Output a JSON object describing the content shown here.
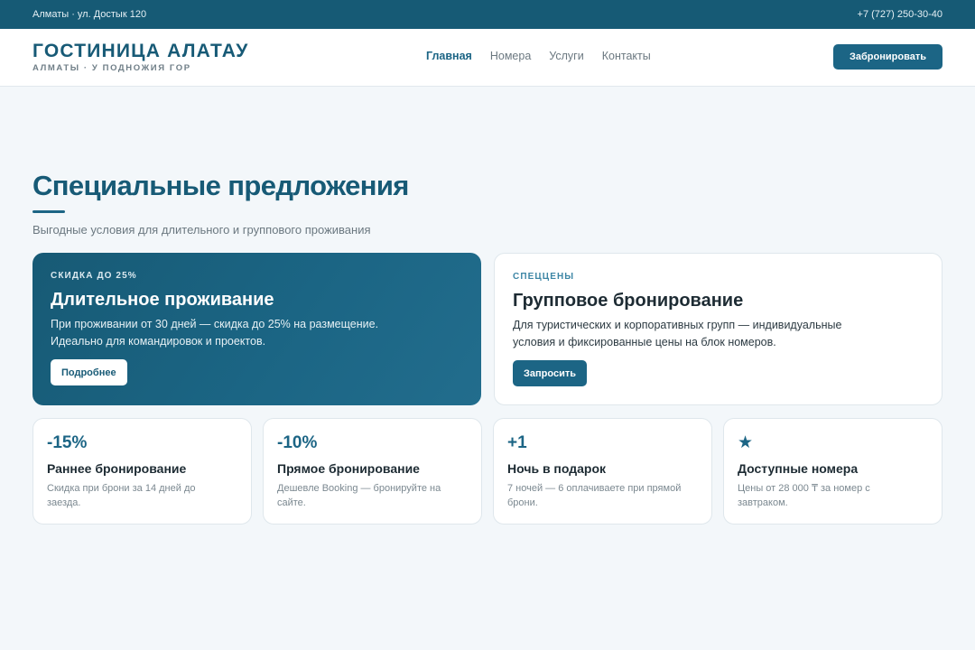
{
  "topbar": {
    "address": "Алматы · ул. Достык 120",
    "phone": "+7 (727) 250-30-40"
  },
  "header": {
    "brand_title": "ГОСТИНИЦА АЛАТАУ",
    "brand_subtitle": "АЛМАТЫ · У ПОДНОЖИЯ ГОР",
    "nav": [
      "Главная",
      "Номера",
      "Услуги",
      "Контакты"
    ],
    "active_nav": "Главная",
    "book_label": "Забронировать"
  },
  "section": {
    "title": "Специальные предложения",
    "subtitle": "Выгодные условия для длительного и группового проживания"
  },
  "offers": [
    {
      "eyebrow": "СКИДКА ДО 25%",
      "title": "Длительное проживание",
      "text": "При проживании от 30 дней — скидка до 25% на размещение. Идеально для командировок и проектов.",
      "button": "Подробнее"
    },
    {
      "eyebrow": "СПЕЦЦЕНЫ",
      "title": "Групповое бронирование",
      "text": "Для туристических и корпоративных групп — индивидуальные условия и фиксированные цены на блок номеров.",
      "button": "Запросить"
    }
  ],
  "perks": [
    {
      "value": "-15%",
      "title": "Раннее бронирование",
      "text": "Скидка при брони за 14 дней до заезда."
    },
    {
      "value": "-10%",
      "title": "Прямое бронирование",
      "text": "Дешевле Booking — бронируйте на сайте."
    },
    {
      "value": "+1",
      "title": "Ночь в подарок",
      "text": "7 ночей — 6 оплачиваете при прямой брони."
    },
    {
      "value": "★",
      "title": "Доступные номера",
      "text": "Цены от 28 000 ₸ за номер с завтраком."
    }
  ],
  "colors": {
    "primary": "#1c6585",
    "topbar": "#165a75",
    "background": "#f3f7fa"
  }
}
